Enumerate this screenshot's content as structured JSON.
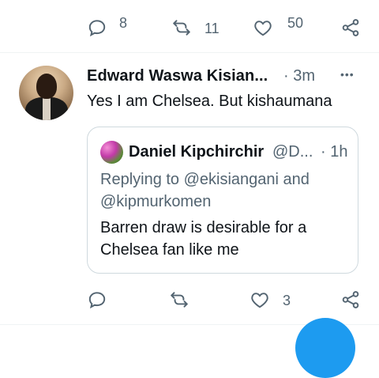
{
  "top_actions": {
    "reply_count": "8",
    "retweet_count": "11",
    "like_count": "50"
  },
  "tweet": {
    "author_name": "Edward Waswa Kisian...",
    "time": "· 3m",
    "text": "Yes I am Chelsea. But  kishaumana",
    "more_glyph": "•••",
    "actions": {
      "like_count": "3"
    }
  },
  "quoted_tweet": {
    "author_name": "Daniel Kipchirchir",
    "handle": "@D...",
    "time": "· 1h",
    "replying_to_line1": "Replying to @ekisiangani and",
    "replying_to_line2": "@kipmurkomen",
    "text_line1": "Barren draw is desirable for a",
    "text_line2": "Chelsea fan like me"
  },
  "colors": {
    "text_primary": "#0f1419",
    "text_secondary": "#536471",
    "border": "#cfd9de",
    "divider": "#eff3f4",
    "accent": "#1d9bf0"
  },
  "icons": [
    "reply-icon",
    "retweet-icon",
    "like-icon",
    "share-icon",
    "more-icon"
  ]
}
